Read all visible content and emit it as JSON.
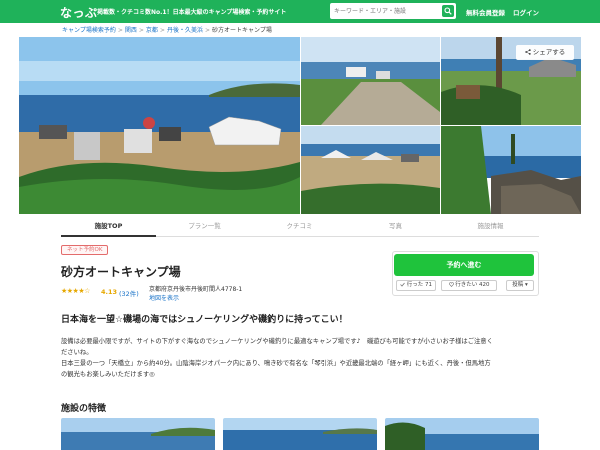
{
  "header": {
    "logo": "なっぷ",
    "tagline": "掲載数・クチコミ数No.1！日本最大級のキャンプ場検索・予約サイト",
    "search_placeholder": "キーワード・エリア・施設",
    "signup": "無料会員登録",
    "login": "ログイン"
  },
  "breadcrumb": {
    "items": [
      "キャンプ場検索予約",
      "関西",
      "京都",
      "丹後・久美浜"
    ],
    "current": "砂方オートキャンプ場",
    "separator": ">"
  },
  "gallery": {
    "share_label": "シェアする"
  },
  "tabs": [
    "施設TOP",
    "プラン一覧",
    "クチコミ",
    "写真",
    "施設情報"
  ],
  "facility": {
    "badge": "ネット予約OK",
    "name": "砂方オートキャンプ場",
    "stars": "★★★★☆",
    "rating": "4.13",
    "reviews": "(32件)",
    "address": "京都府京丹後市丹後町間人4778-1",
    "map_link": "地図を表示"
  },
  "reserve": {
    "button": "予約へ進む",
    "went": "行った 71",
    "want": "行きたい 420",
    "post": "投稿 ▾"
  },
  "description": {
    "headline": "日本海を一望☆磯場の海ではシュノーケリングや磯釣りに持ってこい！",
    "lines": [
      "設備は必要最小限ですが、サイトの下がすぐ海なのでシュノーケリングや磯釣りに最適なキャンプ場です♪　磯遊びも可能ですが小さいお子様はご注意く",
      "ださいね。",
      "日本三景の一つ「天橋立」から約40分。山陰海岸ジオパーク内にあり、鳴き砂で有名な「琴引浜」や近畿最北端の「経ヶ岬」にも近く、丹後・但馬地方",
      "の観光もお楽しみいただけます◎"
    ]
  },
  "features": {
    "title": "施設の特徴"
  },
  "colors": {
    "brand": "#1fb25a",
    "reserve": "#1fc33c",
    "link": "#1a73c8",
    "badge": "#e36b6b",
    "star": "#e6a800"
  }
}
